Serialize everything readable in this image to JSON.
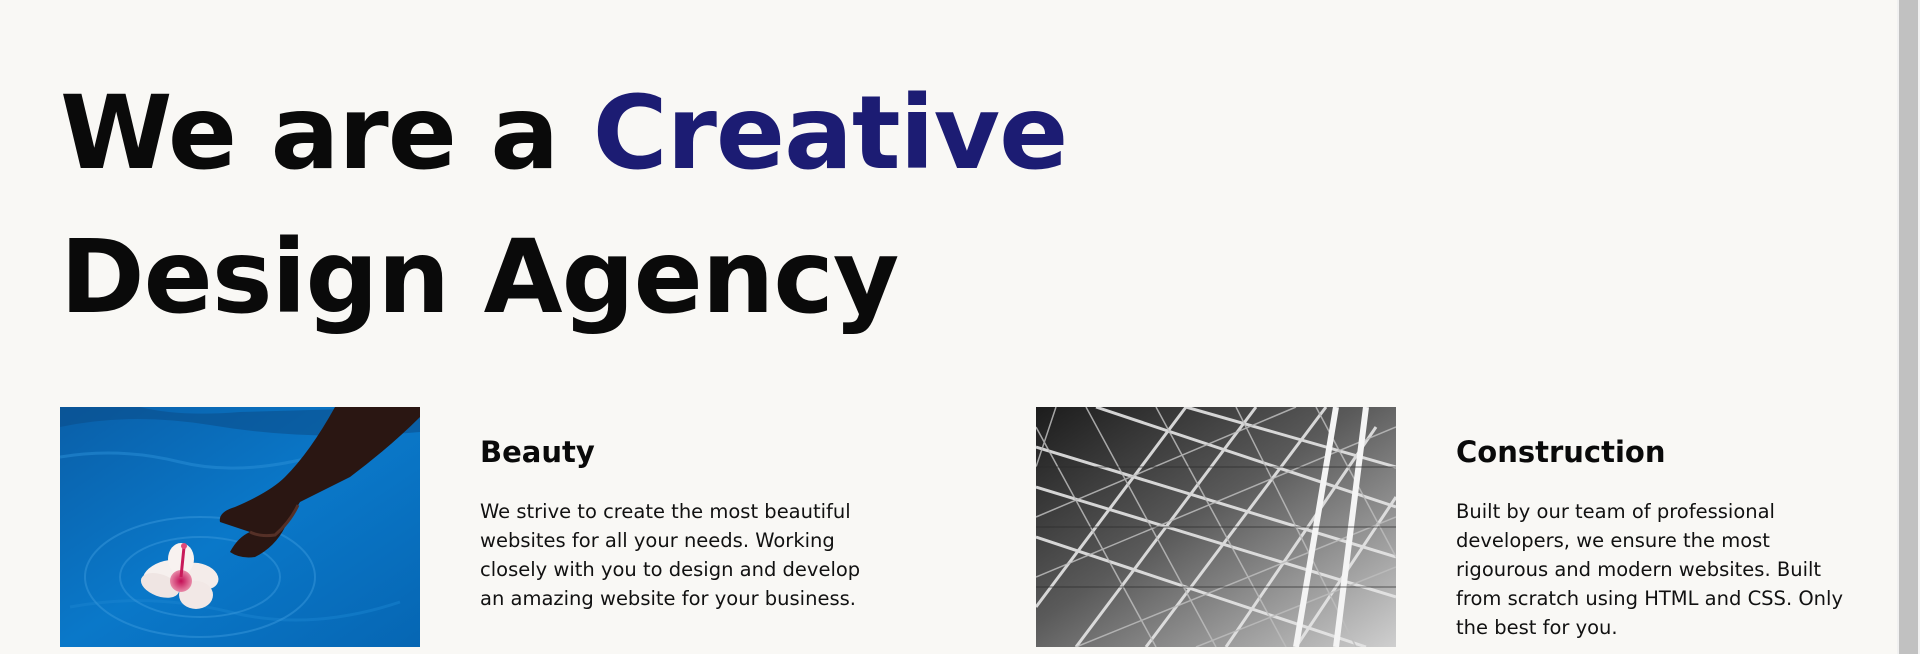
{
  "hero": {
    "headline_prefix": "We are a",
    "headline_accent": "Creative",
    "headline_line2": "Design Agency",
    "accent_color": "#1c1c73"
  },
  "services": [
    {
      "title": "Beauty",
      "image_icon": "hand-flower-water-photo",
      "description": "We strive to create the most beautiful websites for all your needs. Working closely with you to design and develop an amazing website for your business."
    },
    {
      "title": "Construction",
      "image_icon": "steel-structure-photo",
      "description": "Built by our team of professional developers, we ensure the most rigourous and modern websites. Built from scratch using HTML and CSS. Only the best for you."
    }
  ]
}
